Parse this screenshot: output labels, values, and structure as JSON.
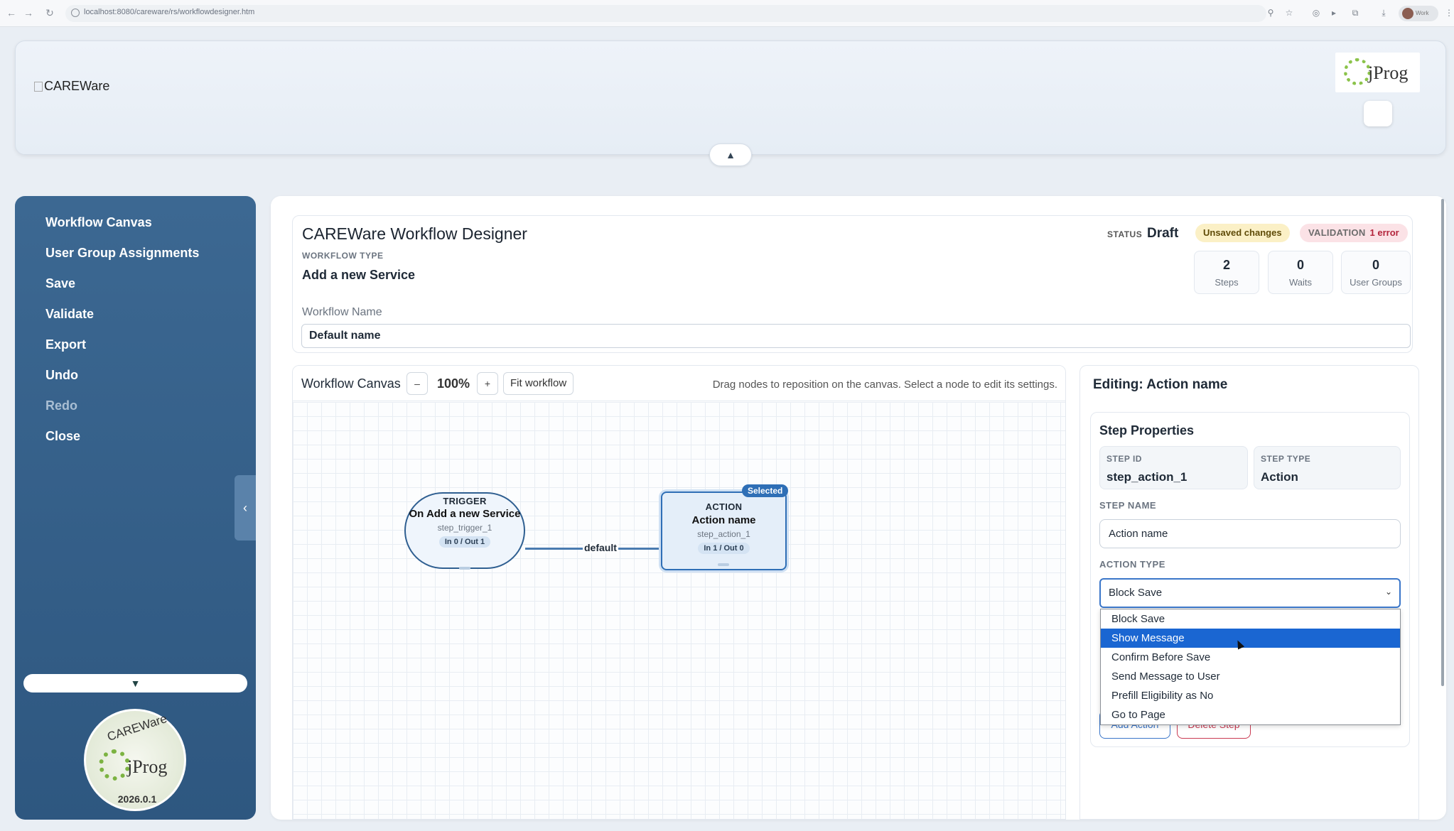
{
  "browser": {
    "url": "localhost:8080/careware/rs/workflowdesigner.htm",
    "profile_label": "Work"
  },
  "header": {
    "logo_alt": "CAREWare",
    "partner_logo_text": "jProg",
    "collapse_arrow": "▲"
  },
  "sidebar": {
    "items": [
      {
        "label": "Workflow Canvas",
        "enabled": true
      },
      {
        "label": "User Group Assignments",
        "enabled": true
      },
      {
        "label": "Save",
        "enabled": true
      },
      {
        "label": "Validate",
        "enabled": true
      },
      {
        "label": "Export",
        "enabled": true
      },
      {
        "label": "Undo",
        "enabled": true
      },
      {
        "label": "Redo",
        "enabled": false
      },
      {
        "label": "Close",
        "enabled": true
      }
    ],
    "toggle_glyph": "‹",
    "scroll_glyph": "▼",
    "seal": {
      "top_text": "CAREWare",
      "mid_text": "jProg",
      "version": "2026.0.1"
    }
  },
  "workflow": {
    "title": "CAREWare Workflow Designer",
    "type_label": "WORKFLOW TYPE",
    "type_value": "Add a new Service",
    "status_label": "STATUS",
    "status_value": "Draft",
    "unsaved_badge": "Unsaved changes",
    "validation_label": "VALIDATION",
    "validation_value": "1 error",
    "stats": [
      {
        "value": "2",
        "label": "Steps"
      },
      {
        "value": "0",
        "label": "Waits"
      },
      {
        "value": "0",
        "label": "User Groups"
      }
    ],
    "name_label": "Workflow Name",
    "name_value": "Default name"
  },
  "canvas": {
    "title": "Workflow Canvas",
    "zoom_out": "–",
    "zoom_level": "100%",
    "zoom_in": "+",
    "fit_label": "Fit workflow",
    "hint": "Drag nodes to reposition on the canvas. Select a node to edit its settings.",
    "edge_label": "default",
    "trigger": {
      "kind": "TRIGGER",
      "name": "On Add a new Service",
      "id": "step_trigger_1",
      "io": "In 0 / Out 1"
    },
    "action": {
      "kind": "ACTION",
      "name": "Action name",
      "id": "step_action_1",
      "io": "In 1 / Out 0",
      "badge": "Selected"
    }
  },
  "properties": {
    "editing_title": "Editing: Action name",
    "section_title": "Step Properties",
    "step_id_label": "STEP ID",
    "step_id_value": "step_action_1",
    "step_type_label": "STEP TYPE",
    "step_type_value": "Action",
    "step_name_label": "STEP NAME",
    "step_name_value": "Action name",
    "action_type_label": "ACTION TYPE",
    "action_type_value": "Block Save",
    "action_options": [
      "Block Save",
      "Show Message",
      "Confirm Before Save",
      "Send Message to User",
      "Prefill Eligibility as No",
      "Go to Page"
    ],
    "highlighted_option": "Show Message",
    "add_action_label": "Add Action",
    "delete_step_label": "Delete Step"
  }
}
